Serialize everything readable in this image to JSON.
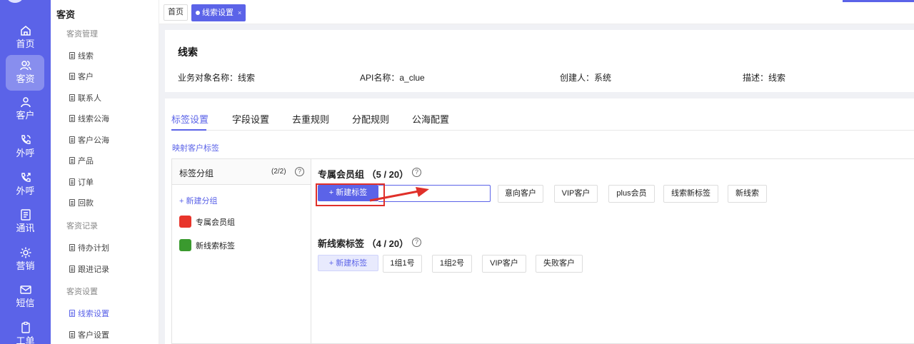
{
  "rail": {
    "items": [
      {
        "label": "首页",
        "icon": "home-icon"
      },
      {
        "label": "客资",
        "icon": "users-icon",
        "active": true
      },
      {
        "label": "客户",
        "icon": "person-icon"
      },
      {
        "label": "外呼",
        "icon": "phone-icon"
      },
      {
        "label": "外呼",
        "icon": "phone-out-icon"
      },
      {
        "label": "通讯",
        "icon": "contacts-icon"
      },
      {
        "label": "营销",
        "icon": "gear-icon"
      },
      {
        "label": "短信",
        "icon": "mail-icon"
      },
      {
        "label": "工单",
        "icon": "clipboard-icon"
      }
    ]
  },
  "sidebar": {
    "title": "客资",
    "groups": [
      {
        "label": "客资管理",
        "items": [
          "线索",
          "客户",
          "联系人",
          "线索公海",
          "客户公海",
          "产品",
          "订单",
          "回款"
        ]
      },
      {
        "label": "客资记录",
        "items": [
          "待办计划",
          "跟进记录"
        ]
      },
      {
        "label": "客资设置",
        "items": [
          "线索设置",
          "客户设置"
        ]
      }
    ],
    "active_item": "线索设置"
  },
  "tabs": {
    "home": "首页",
    "current": "线索设置",
    "close": "×"
  },
  "info": {
    "title": "线索",
    "fields": [
      "业务对象名称：线索",
      "API名称：a_clue",
      "创建人：系统",
      "描述：线索"
    ]
  },
  "main": {
    "tabs": [
      "标签设置",
      "字段设置",
      "去重规则",
      "分配规则",
      "公海配置"
    ],
    "active_tab": "标签设置",
    "map_link": "映射客户标签",
    "groups_panel": {
      "title": "标签分组",
      "count": "(2/2)",
      "add_label": "+ 新建分组",
      "groups": [
        {
          "name": "专属会员组",
          "color": "#e8352b"
        },
        {
          "name": "新线索标签",
          "color": "#3a9a2e"
        }
      ]
    },
    "sections": [
      {
        "title": "专属会员组 （5 / 20）",
        "new_label": "+ 新建标签",
        "tags": [
          "意向客户",
          "VIP客户",
          "plus会员",
          "线索新标签",
          "新线索"
        ]
      },
      {
        "title": "新线索标签 （4 / 20）",
        "new_label": "+ 新建标签",
        "tags": [
          "1组1号",
          "1组2号",
          "VIP客户",
          "失败客户"
        ]
      }
    ],
    "help_glyph": "?"
  },
  "colors": {
    "accent": "#5b63e8",
    "annotation": "#e0302a"
  }
}
